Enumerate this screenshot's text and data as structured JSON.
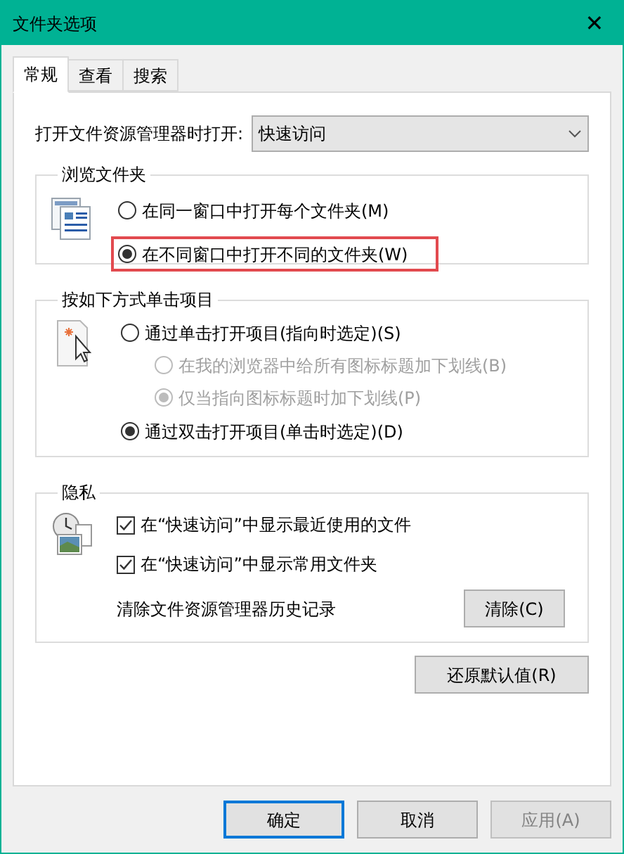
{
  "window": {
    "title": "文件夹选项",
    "close": "✕"
  },
  "tabs": [
    {
      "label": "常规",
      "selected": true
    },
    {
      "label": "查看",
      "selected": false
    },
    {
      "label": "搜索",
      "selected": false
    }
  ],
  "open_with": {
    "label": "打开文件资源管理器时打开:",
    "value": "快速访问"
  },
  "browse_group": {
    "title": "浏览文件夹",
    "options": [
      {
        "label": "在同一窗口中打开每个文件夹(M)",
        "selected": false,
        "highlighted": false
      },
      {
        "label": "在不同窗口中打开不同的文件夹(W)",
        "selected": true,
        "highlighted": true
      }
    ]
  },
  "click_group": {
    "title": "按如下方式单击项目",
    "options": [
      {
        "label": "通过单击打开项目(指向时选定)(S)",
        "selected": false,
        "disabled": false,
        "children": [
          {
            "label": "在我的浏览器中给所有图标标题加下划线(B)",
            "selected": false,
            "disabled": true
          },
          {
            "label": "仅当指向图标标题时加下划线(P)",
            "selected": true,
            "disabled": true
          }
        ]
      },
      {
        "label": "通过双击打开项目(单击时选定)(D)",
        "selected": true,
        "disabled": false
      }
    ]
  },
  "privacy_group": {
    "title": "隐私",
    "checkboxes": [
      {
        "label": "在“快速访问”中显示最近使用的文件",
        "checked": true
      },
      {
        "label": "在“快速访问”中显示常用文件夹",
        "checked": true
      }
    ],
    "clear_label": "清除文件资源管理器历史记录",
    "clear_button": "清除(C)"
  },
  "restore_button": "还原默认值(R)",
  "buttons": [
    {
      "label": "确定",
      "default": true,
      "disabled": false
    },
    {
      "label": "取消",
      "default": false,
      "disabled": false
    },
    {
      "label": "应用(A)",
      "default": false,
      "disabled": true
    }
  ]
}
